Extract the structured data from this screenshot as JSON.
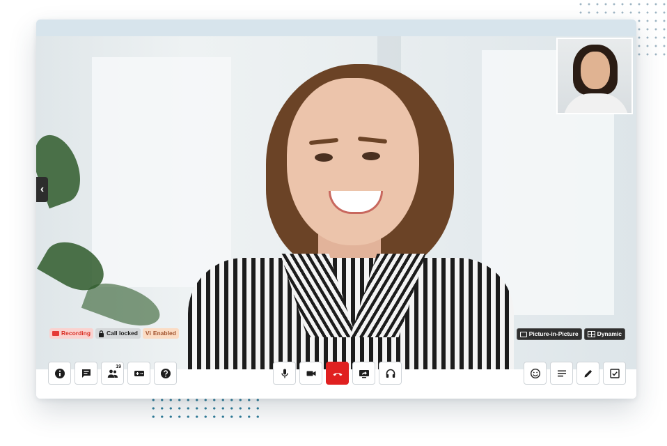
{
  "badges": {
    "recording": "Recording",
    "call_locked": "Call locked",
    "vi_prefix": "Vi",
    "vi_enabled": "Enabled",
    "pip": "Picture-in-Picture",
    "dynamic": "Dynamic"
  },
  "toolbar": {
    "participants_count": "19"
  },
  "icons": {
    "left": [
      "info-icon",
      "chat-icon",
      "participants-icon",
      "gamepad-icon",
      "help-icon"
    ],
    "center": [
      "microphone-icon",
      "camera-icon",
      "end-call-icon",
      "screen-share-icon",
      "headset-icon"
    ],
    "right": [
      "emoji-icon",
      "notes-icon",
      "pencil-icon",
      "checklist-icon"
    ]
  },
  "colors": {
    "end_call": "#e02020",
    "recording": "#d93025",
    "title_bar": "#d7e4ec"
  }
}
